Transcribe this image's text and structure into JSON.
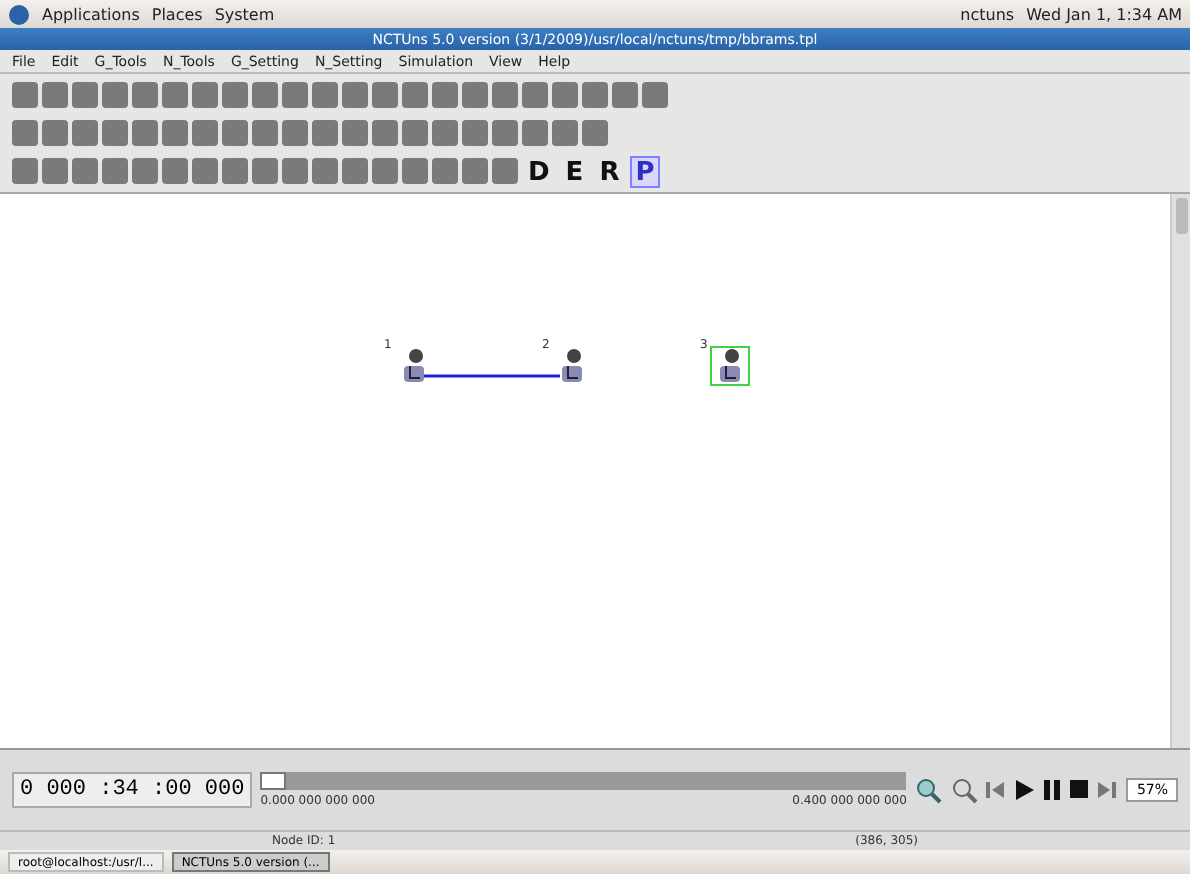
{
  "top_panel": {
    "menus": [
      "Applications",
      "Places",
      "System"
    ],
    "user": "nctuns",
    "clock": "Wed Jan 1, 1:34 AM"
  },
  "window": {
    "title": "NCTUns 5.0 version (3/1/2009)/usr/local/nctuns/tmp/bbrams.tpl"
  },
  "menu_bar": [
    "File",
    "Edit",
    "G_Tools",
    "N_Tools",
    "G_Setting",
    "N_Setting",
    "Simulation",
    "View",
    "Help"
  ],
  "modes": [
    {
      "label": "D",
      "selected": false
    },
    {
      "label": "E",
      "selected": false
    },
    {
      "label": "R",
      "selected": false
    },
    {
      "label": "P",
      "selected": true
    }
  ],
  "nodes": [
    {
      "label": "1",
      "selected": false
    },
    {
      "label": "2",
      "selected": false
    },
    {
      "label": "3",
      "selected": true
    }
  ],
  "status": {
    "clock": "0 000 :34 :00 000",
    "time_start": "0.000 000 000 000",
    "time_end": "0.400 000 000 000",
    "progress": {
      "level": 0.04
    },
    "node_id": "Node ID: 1",
    "coords": "(386, 305)",
    "zoom": "57%"
  },
  "taskbar": [
    {
      "label": "root@localhost:/usr/l...",
      "selected": false
    },
    {
      "label": "NCTUns 5.0 version (...",
      "selected": true
    }
  ]
}
